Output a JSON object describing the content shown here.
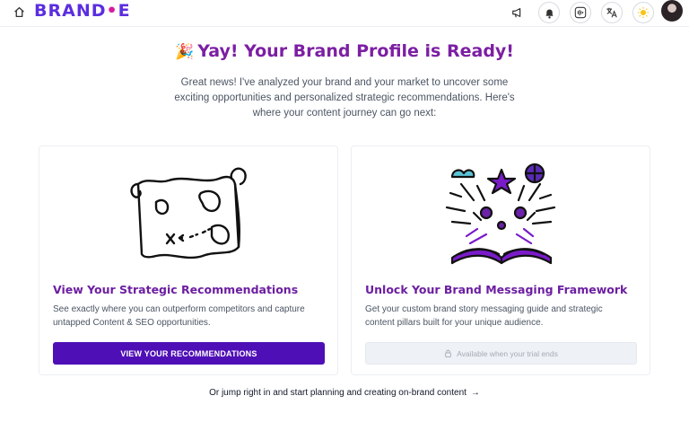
{
  "header": {
    "logo": "BRAND",
    "logo_dot": "•",
    "logo_suffix": "E",
    "icons": [
      "home-icon",
      "megaphone-icon",
      "bell-icon",
      "audio-wave-icon",
      "translate-icon",
      "sun-icon",
      "avatar"
    ]
  },
  "hero": {
    "emoji": "🎉",
    "title": "Yay! Your Brand Profile is Ready!",
    "subtitle": "Great news! I've analyzed your brand and your market to uncover some exciting opportunities and personalized strategic recommendations. Here's where your content journey can go next:"
  },
  "cards": [
    {
      "title": "View Your Strategic Recommendations",
      "description": "See exactly where you can outperform competitors and capture untapped Content & SEO opportunities.",
      "button": "VIEW YOUR RECOMMENDATIONS",
      "illustration": "treasure-map-icon"
    },
    {
      "title": "Unlock Your Brand Messaging Framework",
      "description": "Get your custom brand story messaging guide and strategic content pillars built for your unique audience.",
      "button": "Available when your trial ends",
      "button_icon": "lock-icon",
      "illustration": "open-book-burst-icon"
    }
  ],
  "footer": {
    "jump_link": "Or jump right in and start planning and creating on-brand content",
    "arrow": "→"
  },
  "colors": {
    "brand_purple": "#5b2ee0",
    "title_purple": "#7c1fa3",
    "button_primary": "#4f0fb6",
    "accent_magenta": "#d81b9c"
  }
}
